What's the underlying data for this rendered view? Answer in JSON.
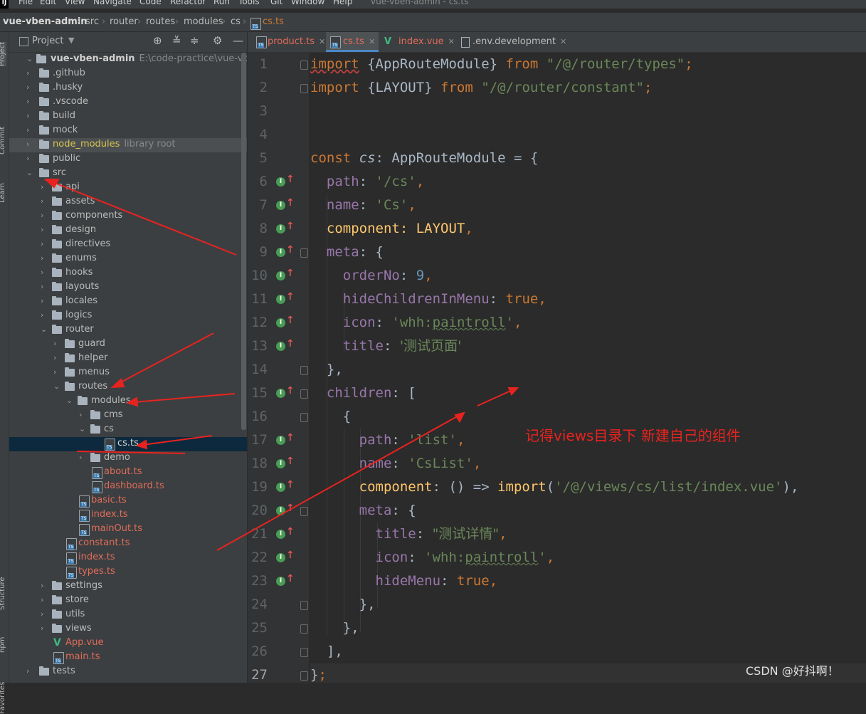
{
  "menu": [
    "File",
    "Edit",
    "View",
    "Navigate",
    "Code",
    "Refactor",
    "Run",
    "Tools",
    "Git",
    "Window",
    "Help"
  ],
  "window_title": "vue-vben-admin - cs.ts",
  "breadcrumb": [
    "vue-vben-admin",
    "src",
    "router",
    "routes",
    "modules",
    "cs",
    "cs.ts"
  ],
  "project_panel": {
    "title": "Project",
    "tree": [
      {
        "label": "vue-vben-admin",
        "path": "E:\\code-practice\\vue-vben-adm"
      },
      {
        "label": ".github"
      },
      {
        "label": ".husky"
      },
      {
        "label": ".vscode"
      },
      {
        "label": "build"
      },
      {
        "label": "mock"
      },
      {
        "label": "node_modules",
        "note": "library root"
      },
      {
        "label": "public"
      },
      {
        "label": "src"
      },
      {
        "label": "api"
      },
      {
        "label": "assets"
      },
      {
        "label": "components"
      },
      {
        "label": "design"
      },
      {
        "label": "directives"
      },
      {
        "label": "enums"
      },
      {
        "label": "hooks"
      },
      {
        "label": "layouts"
      },
      {
        "label": "locales"
      },
      {
        "label": "logics"
      },
      {
        "label": "router"
      },
      {
        "label": "guard"
      },
      {
        "label": "helper"
      },
      {
        "label": "menus"
      },
      {
        "label": "routes"
      },
      {
        "label": "modules"
      },
      {
        "label": "cms"
      },
      {
        "label": "cs"
      },
      {
        "label": "cs.ts"
      },
      {
        "label": "demo"
      },
      {
        "label": "about.ts"
      },
      {
        "label": "dashboard.ts"
      },
      {
        "label": "basic.ts"
      },
      {
        "label": "index.ts"
      },
      {
        "label": "mainOut.ts"
      },
      {
        "label": "constant.ts"
      },
      {
        "label": "index.ts"
      },
      {
        "label": "types.ts"
      },
      {
        "label": "settings"
      },
      {
        "label": "store"
      },
      {
        "label": "utils"
      },
      {
        "label": "views"
      },
      {
        "label": "App.vue"
      },
      {
        "label": "main.ts"
      },
      {
        "label": "tests"
      }
    ]
  },
  "side_strip": [
    "Project",
    "Commit",
    "Learn",
    "Structure",
    "npm",
    "Favorites"
  ],
  "tabs": [
    {
      "label": "product.ts"
    },
    {
      "label": "cs.ts"
    },
    {
      "label": "index.vue"
    },
    {
      "label": ".env.development"
    }
  ],
  "editor": {
    "line_numbers": [
      "1",
      "2",
      "3",
      "4",
      "5",
      "6",
      "7",
      "8",
      "9",
      "10",
      "11",
      "12",
      "13",
      "14",
      "15",
      "16",
      "17",
      "18",
      "19",
      "20",
      "21",
      "22",
      "23",
      "24",
      "25",
      "26",
      "27"
    ],
    "code": [
      [
        "import",
        " {AppRouteModule} ",
        "from",
        " ",
        "\"/@/router/types\"",
        ";"
      ],
      [
        "import",
        " {LAYOUT} ",
        "from",
        " ",
        "\"/@/router/constant\"",
        ";"
      ],
      [],
      [],
      [
        "const",
        " ",
        "cs",
        ": AppRouteModule = {"
      ],
      [
        "  ",
        "path",
        ": ",
        "'/cs'",
        ","
      ],
      [
        "  ",
        "name",
        ": ",
        "'Cs'",
        ","
      ],
      [
        "  ",
        "component",
        ": LAYOUT",
        ","
      ],
      [
        "  ",
        "meta",
        ": {"
      ],
      [
        "    ",
        "orderNo",
        ": ",
        "9",
        ","
      ],
      [
        "    ",
        "hideChildrenInMenu",
        ": ",
        "true",
        ","
      ],
      [
        "    ",
        "icon",
        ": ",
        "'whh:",
        "paintroll",
        "'",
        ","
      ],
      [
        "    ",
        "title",
        ": ",
        "'测试页面'"
      ],
      [
        "  },"
      ],
      [
        "  ",
        "children",
        ": ["
      ],
      [
        "    {"
      ],
      [
        "      ",
        "path",
        ": ",
        "'list'",
        ","
      ],
      [
        "      ",
        "name",
        ": ",
        "'CsList'",
        ","
      ],
      [
        "      ",
        "component",
        ": () => ",
        "import",
        "(",
        "'/@/views/cs/list/index.vue'",
        "),"
      ],
      [
        "      ",
        "meta",
        ": {"
      ],
      [
        "        ",
        "title",
        ": ",
        "\"测试详情\"",
        ","
      ],
      [
        "        ",
        "icon",
        ": ",
        "'whh:",
        "paintroll",
        "'",
        ","
      ],
      [
        "        ",
        "hideMenu",
        ": ",
        "true",
        ","
      ],
      [
        "      },"
      ],
      [
        "    },"
      ],
      [
        "  ],"
      ],
      [
        "}",
        ";"
      ]
    ]
  },
  "annotation": "记得views目录下 新建自己的组件",
  "watermark": "CSDN @好抖啊！",
  "colors": {
    "annotation_red": "#e8231f",
    "keyword": "#cc7832",
    "string": "#6a8759",
    "property": "#9876aa"
  }
}
